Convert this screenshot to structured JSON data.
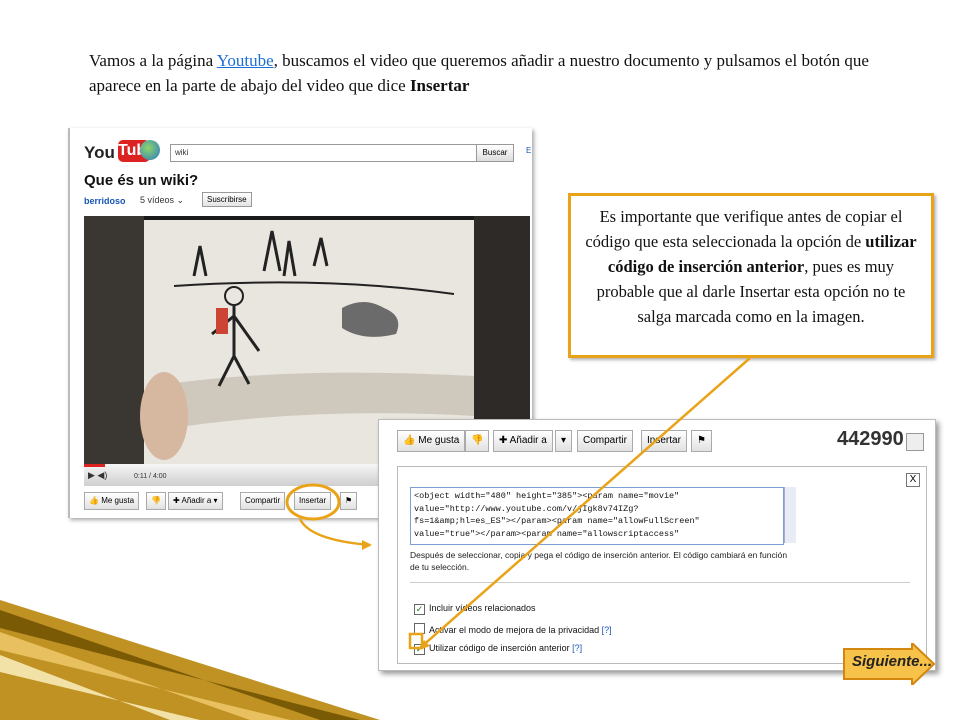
{
  "intro": {
    "text_before": "Vamos a la página ",
    "link": "Youtube",
    "text_after": ", buscamos el video que queremos añadir a nuestro documento y pulsamos el botón que aparece en la parte de abajo del video que dice ",
    "bold_word": "Insertar"
  },
  "youtube": {
    "logo_you": "You",
    "logo_tube": "Tube",
    "search_value": "wiki",
    "search_button": "Buscar",
    "edge_link": "E",
    "video_title": "Que és un wiki?",
    "user": "berridoso",
    "videos_count": "5 vídeos",
    "subscribe": "Suscribirse",
    "time": "0:11 / 4:00",
    "progress_fraction": 0.046,
    "actions": [
      "Me gusta",
      "Añadir a",
      "Compartir",
      "Insertar"
    ]
  },
  "panel": {
    "buttons": [
      "Me gusta",
      "Añadir a",
      "Compartir",
      "Insertar"
    ],
    "views": "442990",
    "close": "X",
    "code_lines": [
      "<object width=\"480\" height=\"385\"><param name=\"movie\"",
      "value=\"http://www.youtube.com/v/jIgk8v74IZg?",
      "fs=1&amp;hl=es_ES\"></param><param name=\"allowFullScreen\"",
      "value=\"true\"></param><param name=\"allowscriptaccess\""
    ],
    "help_text": "Después de seleccionar, copia y pega el código de inserción anterior. El código cambiará en función de tu selección.",
    "options": [
      {
        "label": "Incluir vídeos relacionados",
        "checked": true,
        "help": ""
      },
      {
        "label": "Activar el modo de mejora de la privacidad",
        "checked": false,
        "help": "[?]"
      },
      {
        "label": "Utilizar código de inserción anterior",
        "checked": true,
        "help": "[?]"
      }
    ]
  },
  "callout": {
    "text_before": "Es importante que verifique antes de copiar el código que esta seleccionada la opción de ",
    "bold": "utilizar código de inserción anterior",
    "text_after": ", pues es muy probable que al darle Insertar esta opción no te salga marcada como en la imagen."
  },
  "next_button": "Siguiente...",
  "colors": {
    "accent_orange": "#e9a318",
    "youtube_red": "#d22222",
    "link_blue": "#1a6fd6"
  }
}
